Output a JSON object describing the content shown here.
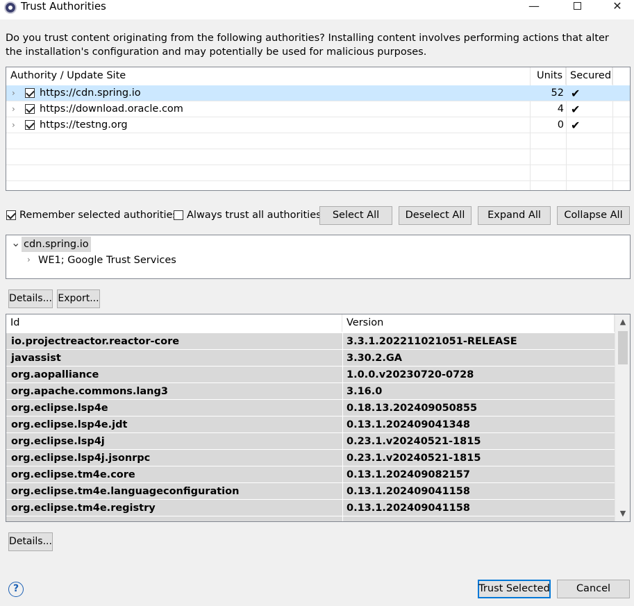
{
  "window": {
    "title": "Trust Authorities",
    "minimize_glyph": "—",
    "close_glyph": "✕"
  },
  "intro_text": "Do you trust content originating from the following authorities?  Installing content involves performing actions that alter the installation's configuration and may potentially be used for malicious purposes.",
  "authorities_table": {
    "headers": [
      "Authority / Update Site",
      "Units",
      "Secured"
    ],
    "rows": [
      {
        "site": "https://cdn.spring.io",
        "units": "52",
        "secured": "✔",
        "checked": true,
        "selected": true
      },
      {
        "site": "https://download.oracle.com",
        "units": "4",
        "secured": "✔",
        "checked": true,
        "selected": false
      },
      {
        "site": "https://testng.org",
        "units": "0",
        "secured": "✔",
        "checked": true,
        "selected": false
      }
    ]
  },
  "options": {
    "remember_label": "Remember selected authorities",
    "remember_checked": true,
    "always_trust_label": "Always trust all authorities",
    "always_trust_checked": false
  },
  "buttons": {
    "select_all": "Select All",
    "deselect_all": "Deselect All",
    "expand_all": "Expand All",
    "collapse_all": "Collapse All",
    "details": "Details...",
    "export": "Export...",
    "details2": "Details...",
    "trust_selected": "Trust Selected",
    "cancel": "Cancel"
  },
  "cert_tree": {
    "root": "cdn.spring.io",
    "child": "WE1; Google Trust Services"
  },
  "units_table": {
    "headers": [
      "Id",
      "Version"
    ],
    "rows": [
      {
        "id": "io.projectreactor.reactor-core",
        "version": "3.3.1.202211021051-RELEASE"
      },
      {
        "id": "javassist",
        "version": "3.30.2.GA"
      },
      {
        "id": "org.aopalliance",
        "version": "1.0.0.v20230720-0728"
      },
      {
        "id": "org.apache.commons.lang3",
        "version": "3.16.0"
      },
      {
        "id": "org.eclipse.lsp4e",
        "version": "0.18.13.202409050855"
      },
      {
        "id": "org.eclipse.lsp4e.jdt",
        "version": "0.13.1.202409041348"
      },
      {
        "id": "org.eclipse.lsp4j",
        "version": "0.23.1.v20240521-1815"
      },
      {
        "id": "org.eclipse.lsp4j.jsonrpc",
        "version": "0.23.1.v20240521-1815"
      },
      {
        "id": "org.eclipse.tm4e.core",
        "version": "0.13.1.202409082157"
      },
      {
        "id": "org.eclipse.tm4e.languageconfiguration",
        "version": "0.13.1.202409041158"
      },
      {
        "id": "org.eclipse.tm4e.registry",
        "version": "0.13.1.202409041158"
      }
    ]
  },
  "icons": {
    "expand": "›",
    "collapse": "⌄",
    "scroll_up": "▲",
    "scroll_down": "▼",
    "help": "?"
  }
}
